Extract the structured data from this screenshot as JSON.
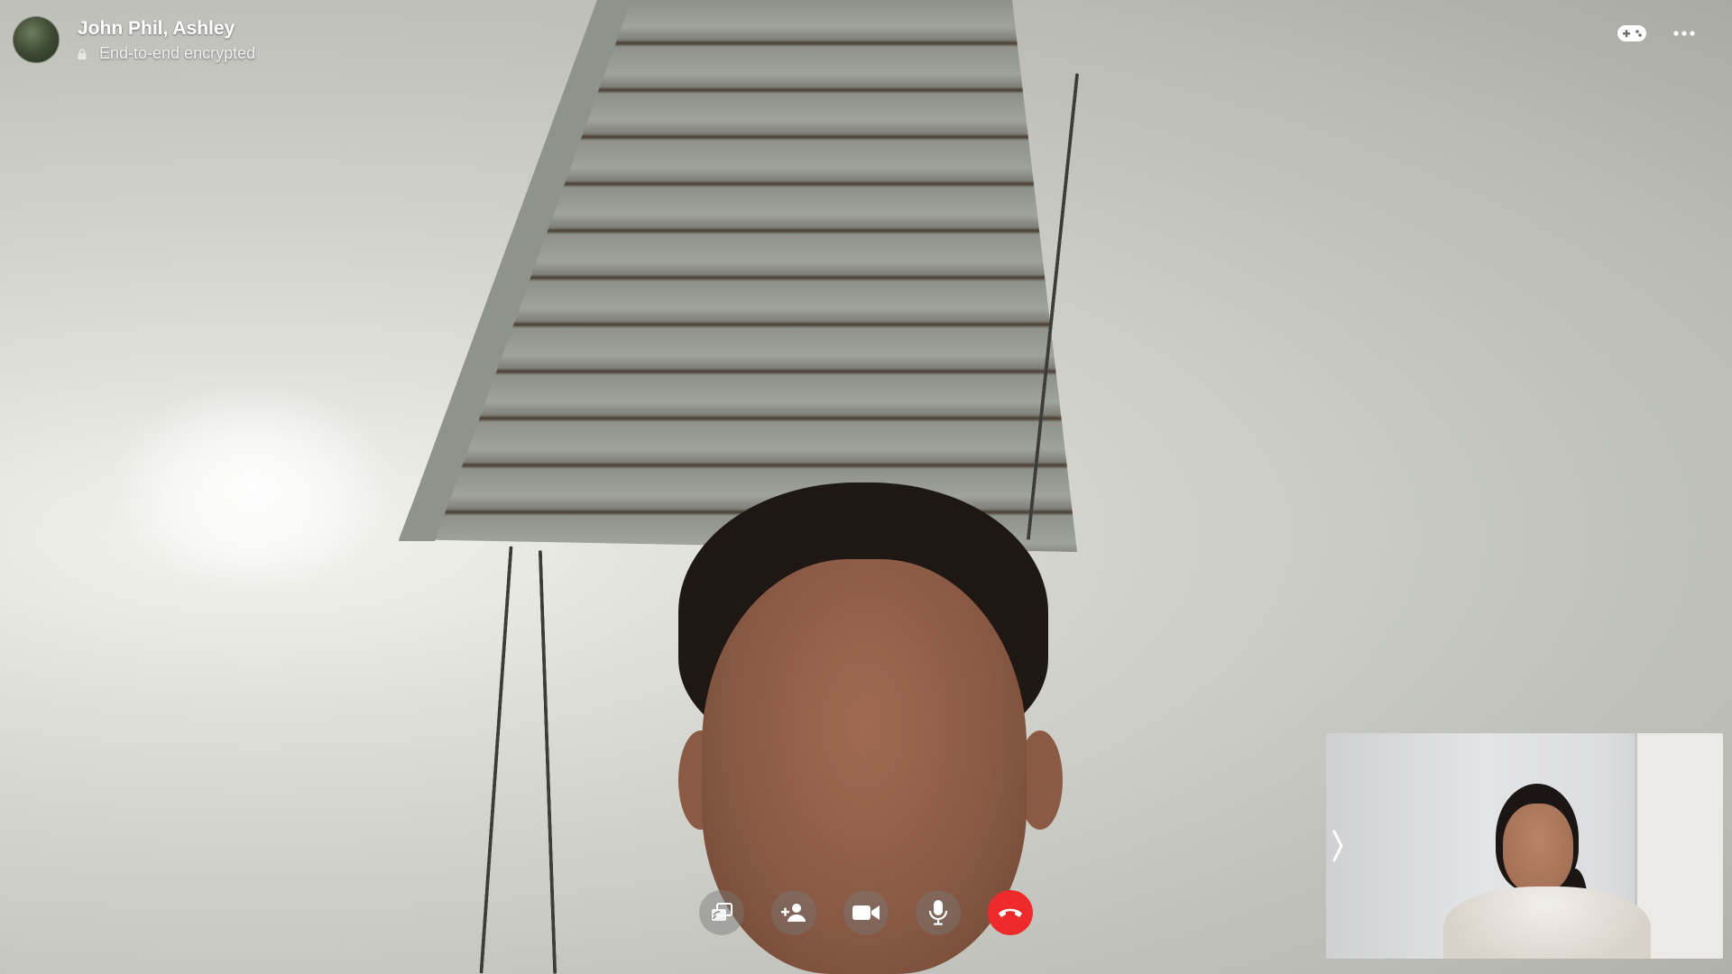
{
  "call": {
    "title": "John Phil, Ashley",
    "subtitle": "End-to-end encrypted"
  },
  "header_icons": {
    "effects": "game-controller-icon",
    "more": "more-options-icon"
  },
  "controls": [
    {
      "name": "share-screen-button",
      "icon": "share-screen-icon"
    },
    {
      "name": "add-person-button",
      "icon": "add-person-icon"
    },
    {
      "name": "camera-button",
      "icon": "camera-icon"
    },
    {
      "name": "microphone-button",
      "icon": "microphone-icon"
    },
    {
      "name": "end-call-button",
      "icon": "hang-up-icon",
      "color": "#ee2a2a"
    }
  ],
  "self_view": {
    "expand_icon": "chevron-right-icon"
  },
  "colors": {
    "end_call": "#ee2a2a",
    "control_bg": "rgba(120,120,120,0.45)",
    "text": "#ffffff"
  }
}
